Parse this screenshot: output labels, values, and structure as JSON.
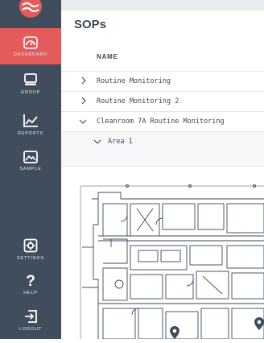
{
  "sidebar": {
    "items": [
      {
        "label": "DASHBOARD",
        "icon": "dashboard-gauge-icon"
      },
      {
        "label": "GROUP",
        "icon": "monitor-icon"
      },
      {
        "label": "REPORTS",
        "icon": "line-chart-icon"
      },
      {
        "label": "SAMPLE",
        "icon": "image-icon"
      },
      {
        "label": "SETTINGS",
        "icon": "gear-icon"
      },
      {
        "label": "HELP",
        "icon": "question-icon"
      },
      {
        "label": "LOGOUT",
        "icon": "logout-icon"
      }
    ],
    "active_color": "#e55b5b",
    "background": "#3f4d5c"
  },
  "page": {
    "title": "SOPs",
    "column_header": "NAME"
  },
  "rows": [
    {
      "label": "Routine Monitoring",
      "expanded": false
    },
    {
      "label": "Routine Monitoring 2",
      "expanded": false
    },
    {
      "label": "Cleanroom 7A Routine Monitoring",
      "expanded": true
    },
    {
      "label": "Area 1",
      "expanded": true
    }
  ],
  "map": {
    "marker_icon": "location-pin-icon",
    "marker_color": "#3f4d5c"
  }
}
